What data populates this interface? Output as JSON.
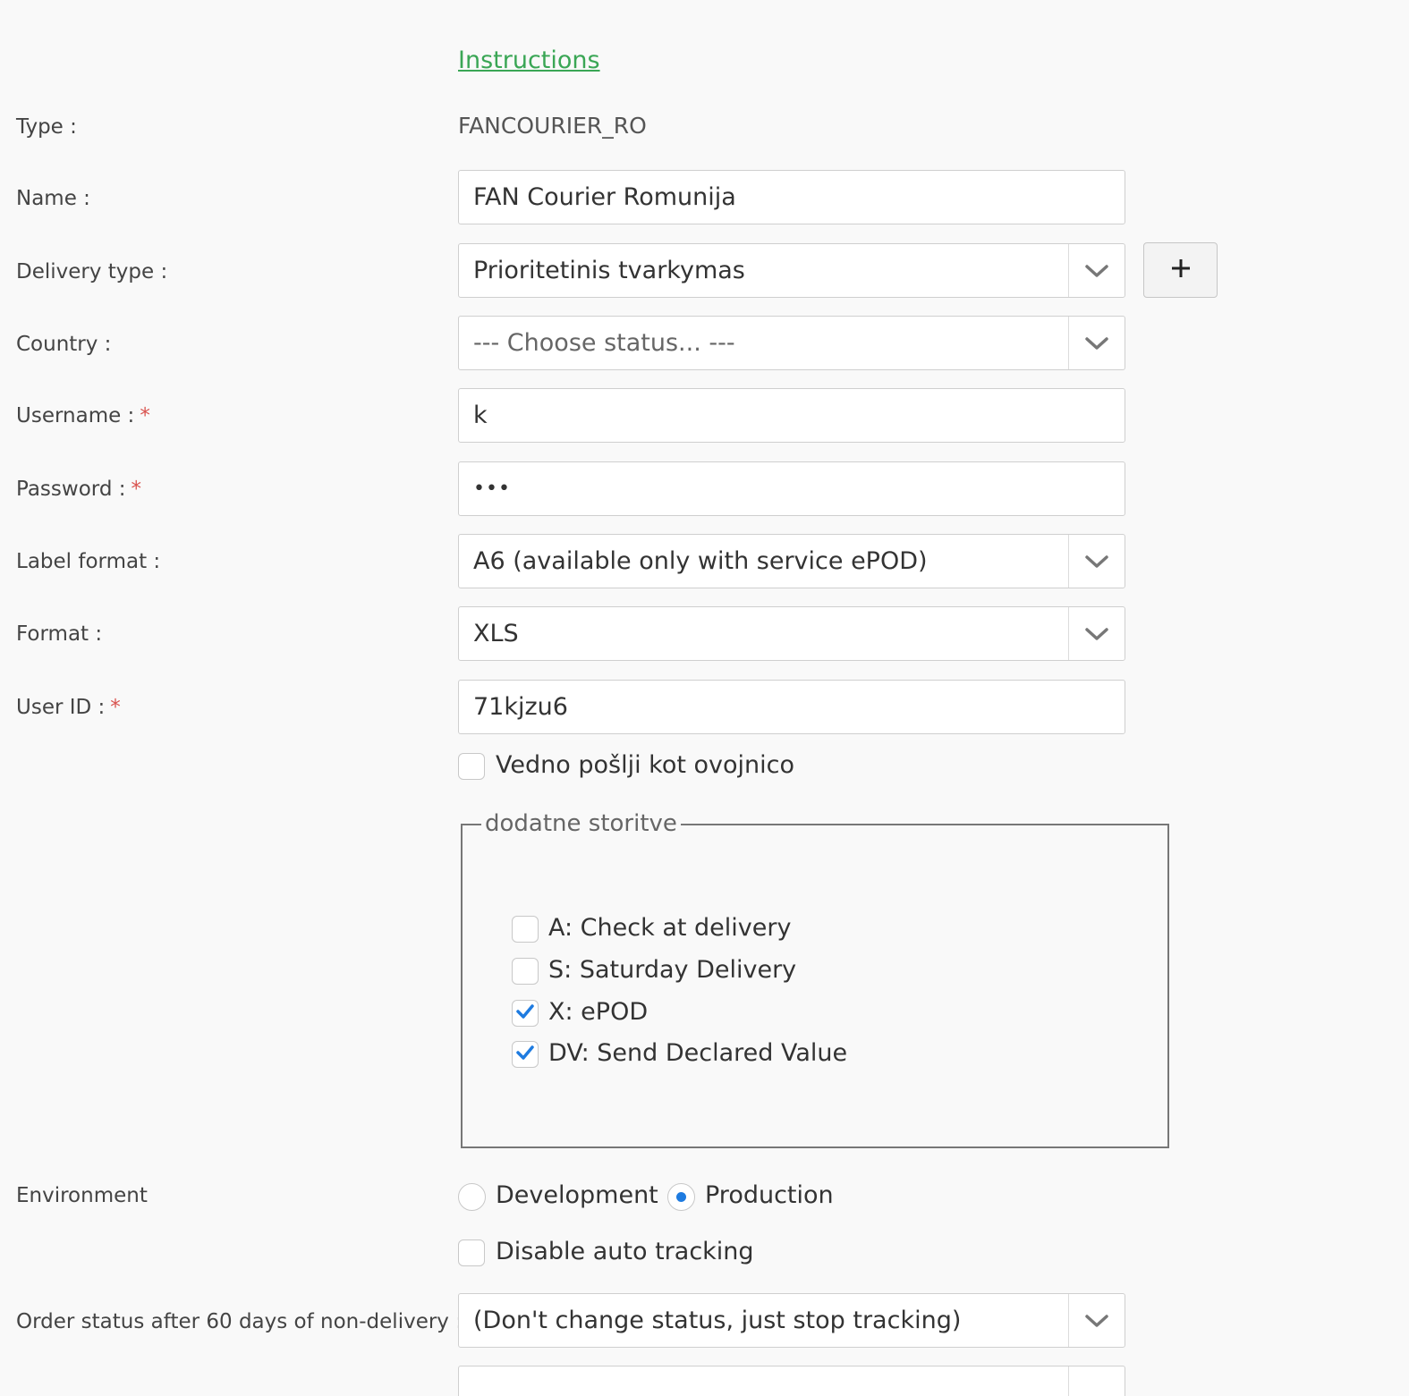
{
  "instructions_link": "Instructions",
  "fields": {
    "type": {
      "label": "Type :",
      "value": "FANCOURIER_RO"
    },
    "name": {
      "label": "Name :",
      "value": "FAN Courier Romunija"
    },
    "delivery_type": {
      "label": "Delivery type :",
      "value": "Prioritetinis tvarkymas",
      "add_label": "+"
    },
    "country": {
      "label": "Country :",
      "value": "--- Choose status... ---"
    },
    "username": {
      "label": "Username :",
      "required": "*",
      "value": "k"
    },
    "password": {
      "label": "Password :",
      "required": "*",
      "value": "•••"
    },
    "label_format": {
      "label": "Label format :",
      "value": "A6 (available only with service ePOD)"
    },
    "format": {
      "label": "Format :",
      "value": "XLS"
    },
    "user_id": {
      "label": "User ID :",
      "required": "*",
      "value": "71kjzu6"
    }
  },
  "always_envelope": {
    "label": "Vedno pošlji kot ovojnico",
    "checked": false
  },
  "additional_services": {
    "legend": "dodatne storitve",
    "items": [
      {
        "label": "A: Check at delivery",
        "checked": false
      },
      {
        "label": "S: Saturday Delivery",
        "checked": false
      },
      {
        "label": "X: ePOD",
        "checked": true
      },
      {
        "label": "DV: Send Declared Value",
        "checked": true
      }
    ]
  },
  "environment": {
    "label": "Environment",
    "options": [
      {
        "label": "Development",
        "selected": false
      },
      {
        "label": "Production",
        "selected": true
      }
    ]
  },
  "disable_auto_tracking": {
    "label": "Disable auto tracking",
    "checked": false
  },
  "order_status_60": {
    "label": "Order status after 60 days of non-delivery :",
    "value": "(Don't change status, just stop tracking)"
  },
  "colors": {
    "link": "#3aa655",
    "required": "#d9534f",
    "check": "#1e7be0"
  }
}
